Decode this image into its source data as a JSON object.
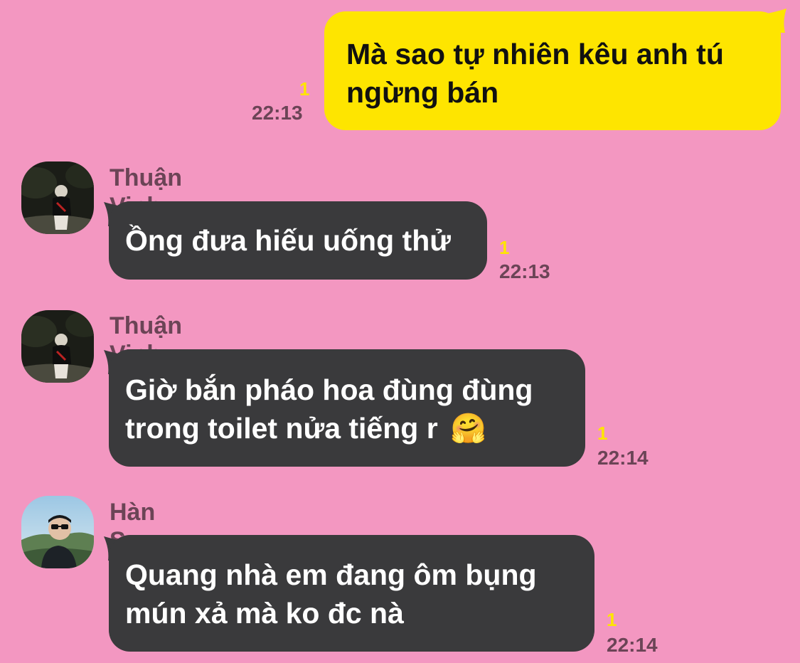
{
  "messages": [
    {
      "direction": "outgoing",
      "text": "Mà sao tự nhiên kêu anh tú ngừng bán",
      "unread": "1",
      "time": "22:13"
    },
    {
      "direction": "incoming",
      "sender": "Thuận Vinh",
      "text": "Ồng đưa hiếu uống thử",
      "unread": "1",
      "time": "22:13",
      "avatar": "avatar-thuan-vinh"
    },
    {
      "direction": "incoming",
      "sender": "Thuận Vinh",
      "text": "Giờ bắn pháo hoa đùng đùng trong toilet nửa tiếng r 🤗",
      "text_line1": "Giờ bắn pháo hoa đùng đùng",
      "text_line2": "trong toilet nửa tiếng r",
      "emoji": "🤗",
      "unread": "1",
      "time": "22:14",
      "avatar": "avatar-thuan-vinh"
    },
    {
      "direction": "incoming",
      "sender": "Hàn Sơn",
      "text": "Quang nhà em đang ôm bụng mún xả mà ko đc nà",
      "unread": "1",
      "time": "22:14",
      "avatar": "avatar-han-son"
    }
  ],
  "colors": {
    "background": "#F397C1",
    "outgoing_bubble": "#FEE500",
    "incoming_bubble": "#3A3A3C",
    "unread_count": "#FEE500",
    "meta_text": "#6B4456"
  }
}
